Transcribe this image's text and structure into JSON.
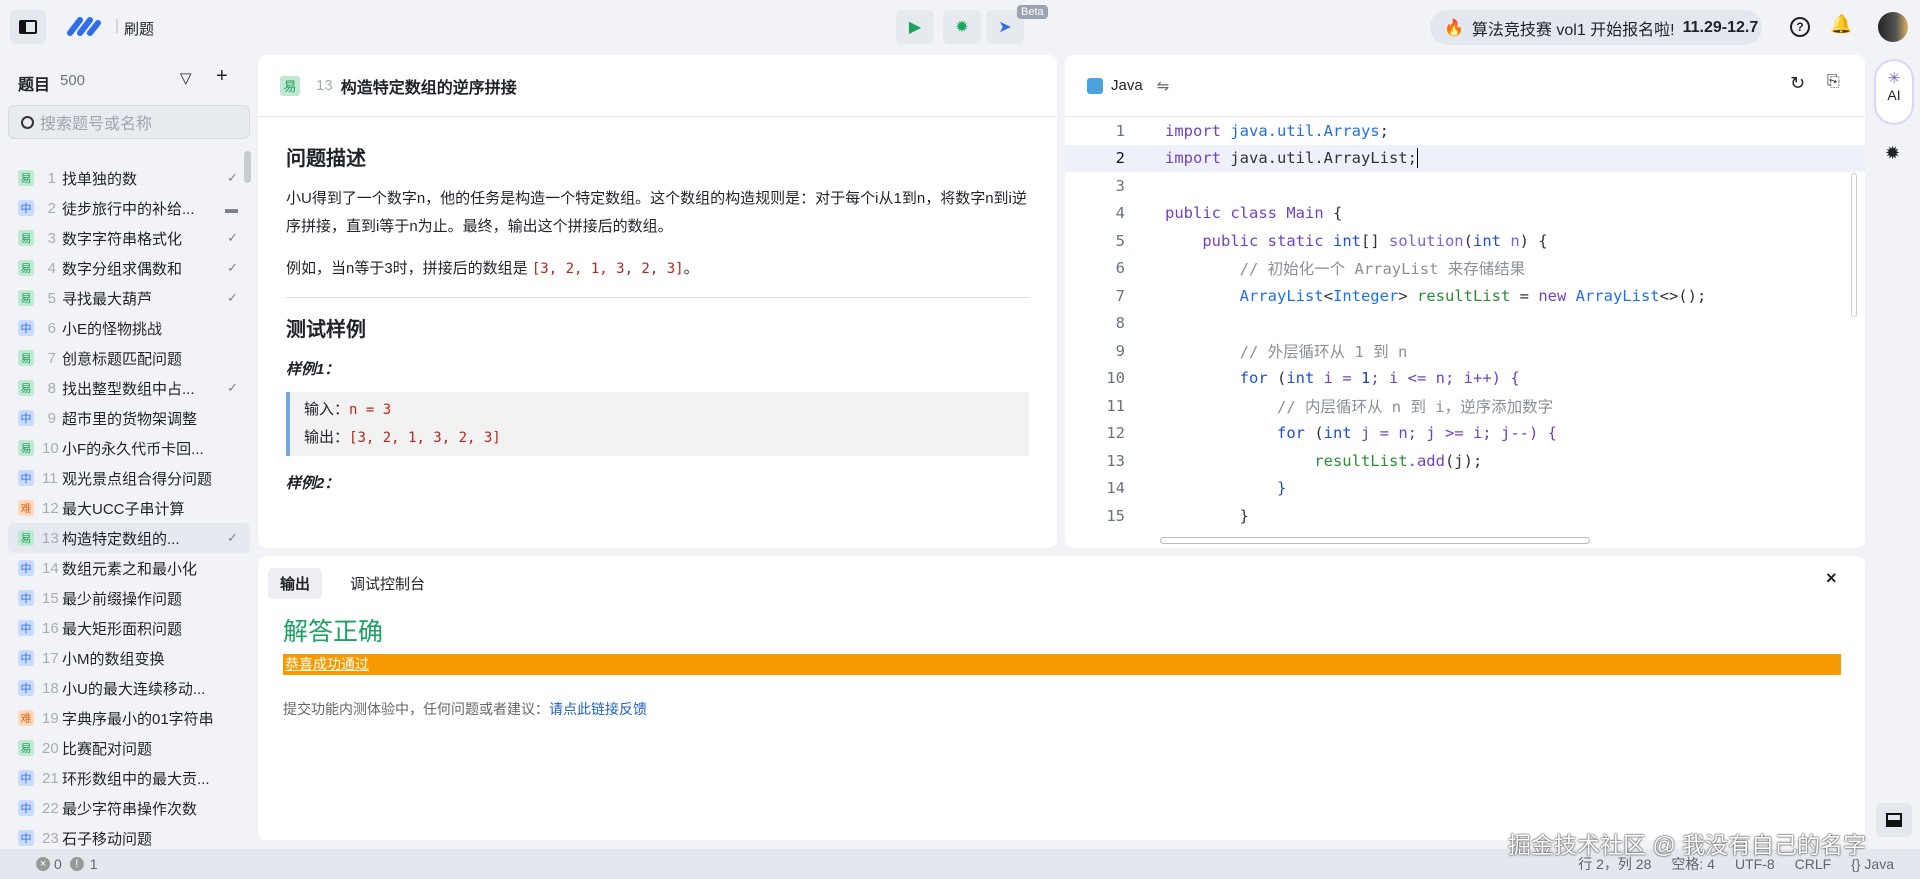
{
  "app": {
    "section": "刷题",
    "beta": "Beta"
  },
  "contest": {
    "text": "算法竞技赛 vol1 开始报名啦!",
    "dates": "11.29-12.7"
  },
  "sidebar": {
    "title": "题目",
    "count": "500",
    "search_placeholder": "搜索题号或名称",
    "items": [
      {
        "tag": "易",
        "lvl": "easy",
        "num": "1",
        "name": "找单独的数",
        "status": "✓"
      },
      {
        "tag": "中",
        "lvl": "mid",
        "num": "2",
        "name": "徒步旅行中的补给...",
        "status": "▬"
      },
      {
        "tag": "易",
        "lvl": "easy",
        "num": "3",
        "name": "数字字符串格式化",
        "status": "✓"
      },
      {
        "tag": "易",
        "lvl": "easy",
        "num": "4",
        "name": "数字分组求偶数和",
        "status": "✓"
      },
      {
        "tag": "易",
        "lvl": "easy",
        "num": "5",
        "name": "寻找最大葫芦",
        "status": "✓"
      },
      {
        "tag": "中",
        "lvl": "mid",
        "num": "6",
        "name": "小E的怪物挑战",
        "status": ""
      },
      {
        "tag": "易",
        "lvl": "easy",
        "num": "7",
        "name": "创意标题匹配问题",
        "status": ""
      },
      {
        "tag": "易",
        "lvl": "easy",
        "num": "8",
        "name": "找出整型数组中占...",
        "status": "✓"
      },
      {
        "tag": "中",
        "lvl": "mid",
        "num": "9",
        "name": "超市里的货物架调整",
        "status": ""
      },
      {
        "tag": "易",
        "lvl": "easy",
        "num": "10",
        "name": "小F的永久代币卡回...",
        "status": ""
      },
      {
        "tag": "中",
        "lvl": "mid",
        "num": "11",
        "name": "观光景点组合得分问题",
        "status": ""
      },
      {
        "tag": "难",
        "lvl": "hard",
        "num": "12",
        "name": "最大UCC子串计算",
        "status": ""
      },
      {
        "tag": "易",
        "lvl": "easy",
        "num": "13",
        "name": "构造特定数组的...",
        "status": "✓",
        "selected": true
      },
      {
        "tag": "中",
        "lvl": "mid",
        "num": "14",
        "name": "数组元素之和最小化",
        "status": ""
      },
      {
        "tag": "中",
        "lvl": "mid",
        "num": "15",
        "name": "最少前缀操作问题",
        "status": ""
      },
      {
        "tag": "中",
        "lvl": "mid",
        "num": "16",
        "name": "最大矩形面积问题",
        "status": ""
      },
      {
        "tag": "中",
        "lvl": "mid",
        "num": "17",
        "name": "小M的数组变换",
        "status": ""
      },
      {
        "tag": "中",
        "lvl": "mid",
        "num": "18",
        "name": "小U的最大连续移动...",
        "status": ""
      },
      {
        "tag": "难",
        "lvl": "hard",
        "num": "19",
        "name": "字典序最小的01字符串",
        "status": ""
      },
      {
        "tag": "易",
        "lvl": "easy",
        "num": "20",
        "name": "比赛配对问题",
        "status": ""
      },
      {
        "tag": "中",
        "lvl": "mid",
        "num": "21",
        "name": "环形数组中的最大贡...",
        "status": ""
      },
      {
        "tag": "中",
        "lvl": "mid",
        "num": "22",
        "name": "最少字符串操作次数",
        "status": ""
      },
      {
        "tag": "中",
        "lvl": "mid",
        "num": "23",
        "name": "石子移动问题",
        "status": ""
      }
    ]
  },
  "problem": {
    "tag": "易",
    "num": "13",
    "title": "构造特定数组的逆序拼接",
    "desc_heading": "问题描述",
    "desc": "小U得到了一个数字n，他的任务是构造一个特定数组。这个数组的构造规则是：对于每个i从1到n，将数字n到i逆序拼接，直到i等于n为止。最终，输出这个拼接后的数组。",
    "example_prefix": "例如，当n等于3时，拼接后的数组是 ",
    "example_value": "[3, 2, 1, 3, 2, 3]",
    "example_suffix": "。",
    "tests_heading": "测试样例",
    "sample1": "样例1：",
    "input_label": "输入：",
    "input_value": "n = 3",
    "output_label": "输出：",
    "output_value": "[3, 2, 1, 3, 2, 3]",
    "sample2": "样例2："
  },
  "editor": {
    "language": "Java",
    "lines": [
      [
        [
          "import",
          "k"
        ],
        [
          " java.util.Arrays",
          "ty"
        ],
        [
          ";",
          "p"
        ]
      ],
      [
        [
          "import",
          "k"
        ],
        [
          " java.util.ArrayList;",
          "p"
        ]
      ],
      [],
      [
        [
          "public class ",
          "k"
        ],
        [
          "Main ",
          "k"
        ],
        [
          "{",
          "p"
        ]
      ],
      [
        [
          "    public static ",
          "k"
        ],
        [
          "int",
          "kw"
        ],
        [
          "[] ",
          "p"
        ],
        [
          "solution",
          "fn"
        ],
        [
          "(",
          "p"
        ],
        [
          "int",
          "kw"
        ],
        [
          " n",
          "fn"
        ],
        [
          ") {",
          "p"
        ]
      ],
      [
        [
          "        // 初始化一个 ArrayList 来存储结果",
          "cm"
        ]
      ],
      [
        [
          "        ArrayList",
          "ty"
        ],
        [
          "<",
          "p"
        ],
        [
          "Integer",
          "ty"
        ],
        [
          "> ",
          "p"
        ],
        [
          "resultList",
          "v"
        ],
        [
          " = ",
          "p"
        ],
        [
          "new ",
          "k"
        ],
        [
          "ArrayList",
          "ty"
        ],
        [
          "<>();",
          "p"
        ]
      ],
      [],
      [
        [
          "        // 外层循环从 1 到 n",
          "cm"
        ]
      ],
      [
        [
          "        for",
          "kw"
        ],
        [
          " (",
          "p"
        ],
        [
          "int",
          "kw"
        ],
        [
          " i = ",
          "k"
        ],
        [
          "1",
          "n"
        ],
        [
          "; i <= n; i++) {",
          "k"
        ]
      ],
      [
        [
          "            // 内层循环从 n 到 i，逆序添加数字",
          "cm"
        ]
      ],
      [
        [
          "            for",
          "kw"
        ],
        [
          " (",
          "p"
        ],
        [
          "int",
          "kw"
        ],
        [
          " j = n; j >= i; j--) {",
          "k"
        ]
      ],
      [
        [
          "                resultList",
          "v"
        ],
        [
          ".add",
          "k"
        ],
        [
          "(j);",
          "p"
        ]
      ],
      [
        [
          "            }",
          "kw"
        ]
      ],
      [
        [
          "        }",
          "p"
        ]
      ]
    ]
  },
  "output": {
    "tab_output": "输出",
    "tab_console": "调试控制台",
    "result": "解答正确",
    "banner": "恭喜成功通过",
    "feedback_prefix": "提交功能内测体验中，任何问题或者建议：",
    "feedback_link": "请点此链接反馈"
  },
  "rail": {
    "ai": "AI"
  },
  "status": {
    "errors": "0",
    "warnings": "1",
    "position": "行 2，列 28",
    "indent": "空格: 4",
    "encoding": "UTF-8",
    "eol": "CRLF",
    "lang": "Java"
  },
  "watermark": "掘金技术社区 @ 我没有自己的名字",
  "colors": {
    "easy": "#1e9b5a",
    "mid": "#2f6ee8",
    "hard": "#e06a1b",
    "success": "#1aa260",
    "banner": "#f59a00"
  }
}
